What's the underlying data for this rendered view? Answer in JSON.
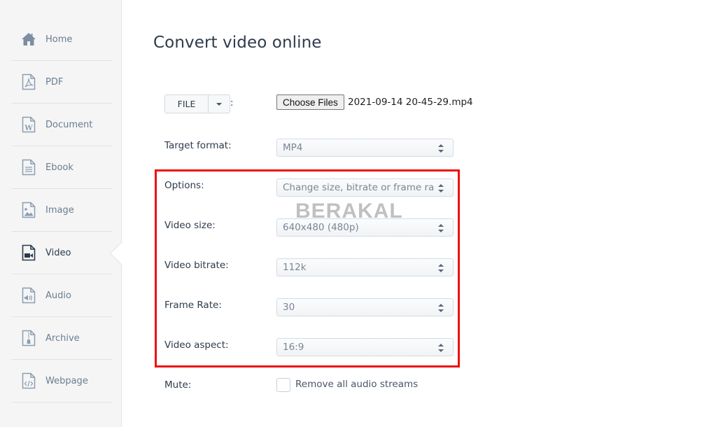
{
  "sidebar": {
    "items": [
      {
        "label": "Home",
        "icon": "home-icon",
        "active": false
      },
      {
        "label": "PDF",
        "icon": "pdf-file-icon",
        "active": false
      },
      {
        "label": "Document",
        "icon": "word-document-icon",
        "active": false
      },
      {
        "label": "Ebook",
        "icon": "ebook-icon",
        "active": false
      },
      {
        "label": "Image",
        "icon": "image-file-icon",
        "active": false
      },
      {
        "label": "Video",
        "icon": "video-file-icon",
        "active": true
      },
      {
        "label": "Audio",
        "icon": "audio-file-icon",
        "active": false
      },
      {
        "label": "Archive",
        "icon": "archive-file-icon",
        "active": false
      },
      {
        "label": "Webpage",
        "icon": "webpage-file-icon",
        "active": false
      }
    ]
  },
  "main": {
    "title": "Convert video online",
    "file_row": {
      "source_button": "FILE",
      "colon": ":",
      "choose_files_label": "Choose Files",
      "selected_file": "2021-09-14 20-45-29.mp4"
    },
    "target_format": {
      "label": "Target format:",
      "value": "MP4"
    },
    "options": {
      "label": "Options:",
      "value": "Change size, bitrate or frame rate"
    },
    "video_size": {
      "label": "Video size:",
      "value": "640x480 (480p)"
    },
    "video_bitrate": {
      "label": "Video bitrate:",
      "value": "112k"
    },
    "frame_rate": {
      "label": "Frame Rate:",
      "value": "30"
    },
    "video_aspect": {
      "label": "Video aspect:",
      "value": "16:9"
    },
    "mute": {
      "label": "Mute:",
      "checkbox_label": "Remove all audio streams",
      "checked": false
    }
  },
  "overlay": {
    "watermark": "BERAKAL",
    "highlight_color": "#ee0f0f"
  }
}
